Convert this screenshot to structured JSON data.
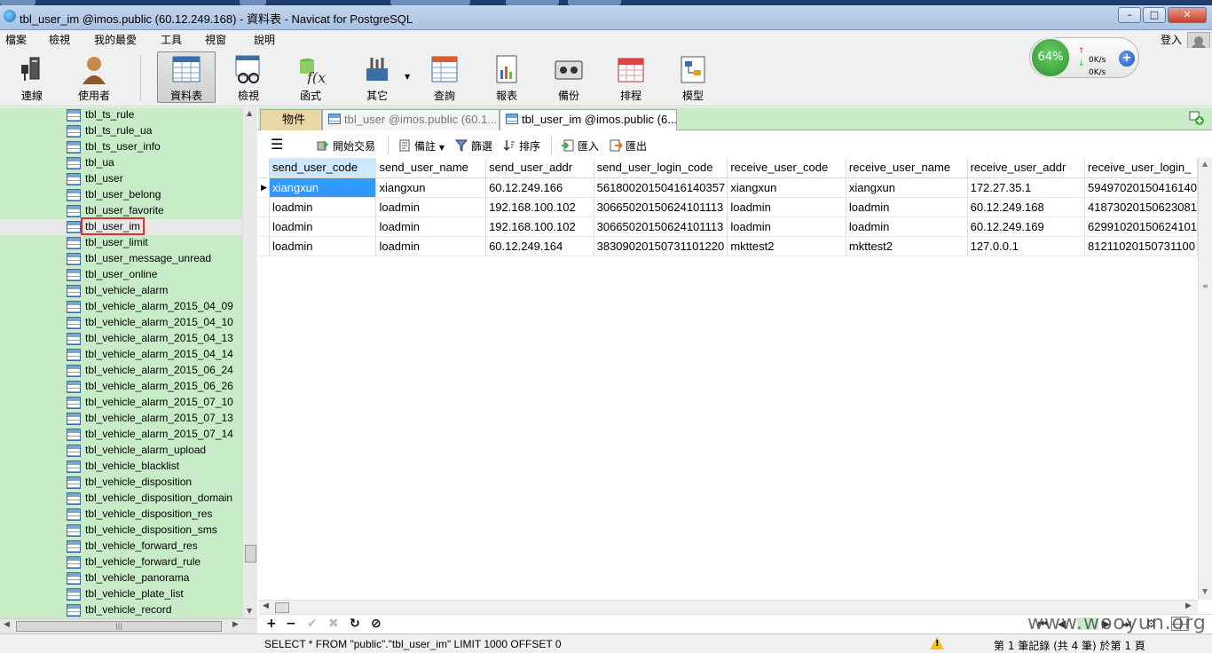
{
  "window": {
    "title": "tbl_user_im @imos.public (60.12.249.168) - 資料表 - Navicat for PostgreSQL",
    "minimize": "–",
    "maximize": "□",
    "close": "✕"
  },
  "menu": [
    "檔案",
    "檢視",
    "我的最愛",
    "工具",
    "視窗",
    "說明"
  ],
  "login": "登入",
  "toolbar": [
    {
      "label": "連線",
      "icon": "connection-icon"
    },
    {
      "label": "使用者",
      "icon": "user-icon"
    },
    {
      "label": "資料表",
      "icon": "table-icon",
      "active": true
    },
    {
      "label": "檢視",
      "icon": "view-icon"
    },
    {
      "label": "函式",
      "icon": "function-icon"
    },
    {
      "label": "其它",
      "icon": "other-icon"
    },
    {
      "label": "查詢",
      "icon": "query-icon"
    },
    {
      "label": "報表",
      "icon": "report-icon"
    },
    {
      "label": "備份",
      "icon": "backup-icon"
    },
    {
      "label": "排程",
      "icon": "schedule-icon"
    },
    {
      "label": "模型",
      "icon": "model-icon"
    }
  ],
  "speed": {
    "percent": "64%",
    "up": "0K/s",
    "down": "0K/s",
    "up_arrow": "↑",
    "down_arrow": "↓",
    "plus": "+"
  },
  "tree": [
    "tbl_ts_rule",
    "tbl_ts_rule_ua",
    "tbl_ts_user_info",
    "tbl_ua",
    "tbl_user",
    "tbl_user_belong",
    "tbl_user_favorite",
    "tbl_user_im",
    "tbl_user_limit",
    "tbl_user_message_unread",
    "tbl_user_online",
    "tbl_vehicle_alarm",
    "tbl_vehicle_alarm_2015_04_09",
    "tbl_vehicle_alarm_2015_04_10",
    "tbl_vehicle_alarm_2015_04_13",
    "tbl_vehicle_alarm_2015_04_14",
    "tbl_vehicle_alarm_2015_06_24",
    "tbl_vehicle_alarm_2015_06_26",
    "tbl_vehicle_alarm_2015_07_10",
    "tbl_vehicle_alarm_2015_07_13",
    "tbl_vehicle_alarm_2015_07_14",
    "tbl_vehicle_alarm_upload",
    "tbl_vehicle_blacklist",
    "tbl_vehicle_disposition",
    "tbl_vehicle_disposition_domain",
    "tbl_vehicle_disposition_res",
    "tbl_vehicle_disposition_sms",
    "tbl_vehicle_forward_res",
    "tbl_vehicle_forward_rule",
    "tbl_vehicle_panorama",
    "tbl_vehicle_plate_list",
    "tbl_vehicle_record"
  ],
  "tree_selected": "tbl_user_im",
  "tabs": {
    "objects": "物件",
    "user": "tbl_user @imos.public (60.1...",
    "userim": "tbl_user_im @imos.public (6..."
  },
  "gridbar": {
    "begin_tx": "開始交易",
    "memo": "備註",
    "filter": "篩選",
    "sort": "排序",
    "import": "匯入",
    "export": "匯出"
  },
  "columns": [
    "send_user_code",
    "send_user_name",
    "send_user_addr",
    "send_user_login_code",
    "receive_user_code",
    "receive_user_name",
    "receive_user_addr",
    "receive_user_login_"
  ],
  "rows": [
    [
      "xiangxun",
      "xiangxun",
      "60.12.249.166",
      "56180020150416140357",
      "xiangxun",
      "xiangxun",
      "172.27.35.1",
      "59497020150416140"
    ],
    [
      "loadmin",
      "loadmin",
      "192.168.100.102",
      "30665020150624101113",
      "loadmin",
      "loadmin",
      "60.12.249.168",
      "41873020150623081"
    ],
    [
      "loadmin",
      "loadmin",
      "192.168.100.102",
      "30665020150624101113",
      "loadmin",
      "loadmin",
      "60.12.249.169",
      "62991020150624101"
    ],
    [
      "loadmin",
      "loadmin",
      "60.12.249.164",
      "38309020150731101220",
      "mkttest2",
      "mkttest2",
      "127.0.0.1",
      "81211020150731100"
    ]
  ],
  "navbar": {
    "add": "+",
    "delete": "−",
    "apply": "✔",
    "cancel": "✖",
    "refresh": "↻",
    "stop": "⊘"
  },
  "status": {
    "sql": "SELECT * FROM \"public\".\"tbl_user_im\" LIMIT 1000 OFFSET 0",
    "records": "第 1 筆記錄 (共 4 筆) 於第 1 頁"
  },
  "watermark": "www.wooyun.org"
}
